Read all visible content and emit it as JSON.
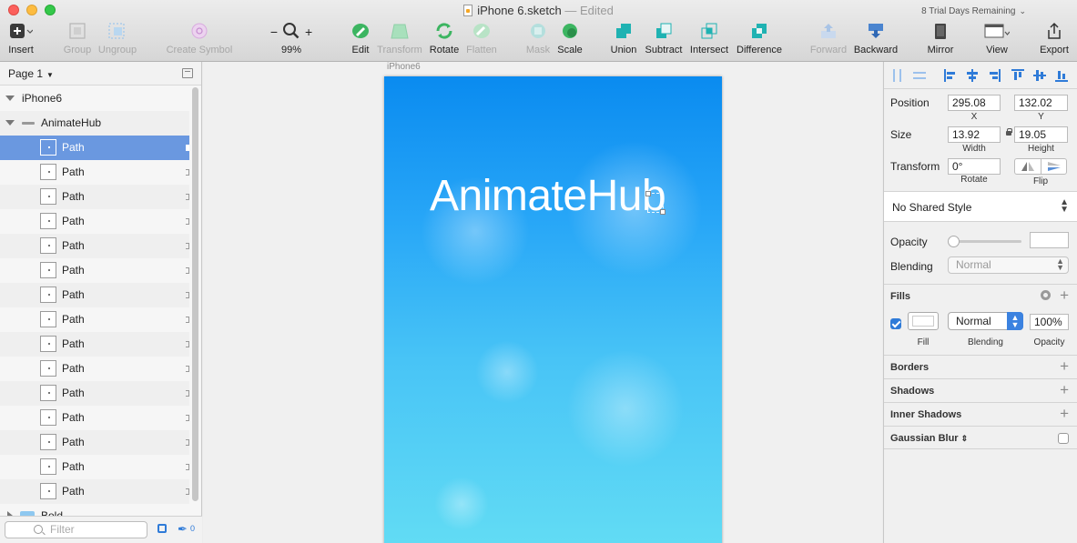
{
  "window": {
    "title": "iPhone 6.sketch",
    "edited": "— Edited",
    "trial": "8 Trial Days Remaining"
  },
  "toolbar": {
    "insert": "Insert",
    "group": "Group",
    "ungroup": "Ungroup",
    "create_symbol": "Create Symbol",
    "zoom_minus": "−",
    "zoom_plus": "+",
    "zoom": "99%",
    "edit": "Edit",
    "transform": "Transform",
    "rotate": "Rotate",
    "flatten": "Flatten",
    "mask": "Mask",
    "scale": "Scale",
    "union": "Union",
    "subtract": "Subtract",
    "intersect": "Intersect",
    "difference": "Difference",
    "forward": "Forward",
    "backward": "Backward",
    "mirror": "Mirror",
    "view": "View",
    "export": "Export"
  },
  "layers_panel": {
    "page": "Page 1",
    "artboard": "iPhone6",
    "group": "AnimateHub",
    "paths": [
      "Path",
      "Path",
      "Path",
      "Path",
      "Path",
      "Path",
      "Path",
      "Path",
      "Path",
      "Path",
      "Path",
      "Path",
      "Path",
      "Path",
      "Path"
    ],
    "partial_row": "Bold...",
    "filter_placeholder": "Filter",
    "edit_count": "0"
  },
  "canvas": {
    "artboard_label": "iPhone6",
    "title_text": "AnimateHub"
  },
  "inspector": {
    "position_label": "Position",
    "position_x": "295.08",
    "position_y": "132.02",
    "x_label": "X",
    "y_label": "Y",
    "size_label": "Size",
    "width": "13.92",
    "height": "19.05",
    "width_label": "Width",
    "height_label": "Height",
    "transform_label": "Transform",
    "rotate_value": "0°",
    "rotate_label": "Rotate",
    "flip_label": "Flip",
    "shared_style": "No Shared Style",
    "opacity_label": "Opacity",
    "blending_label": "Blending",
    "blending_value": "Normal",
    "fills_label": "Fills",
    "fill_label": "Fill",
    "fill_blending_label": "Blending",
    "fill_blending_value": "Normal",
    "fill_opacity_value": "100%",
    "fill_opacity_label": "Opacity",
    "borders_label": "Borders",
    "shadows_label": "Shadows",
    "inner_shadows_label": "Inner Shadows",
    "gaussian_blur_label": "Gaussian Blur"
  },
  "colors": {
    "selection": "#6a98e0",
    "accent": "#2f7bd8",
    "artboard_top": "#0a8bf0",
    "artboard_bottom": "#62dcf4"
  }
}
